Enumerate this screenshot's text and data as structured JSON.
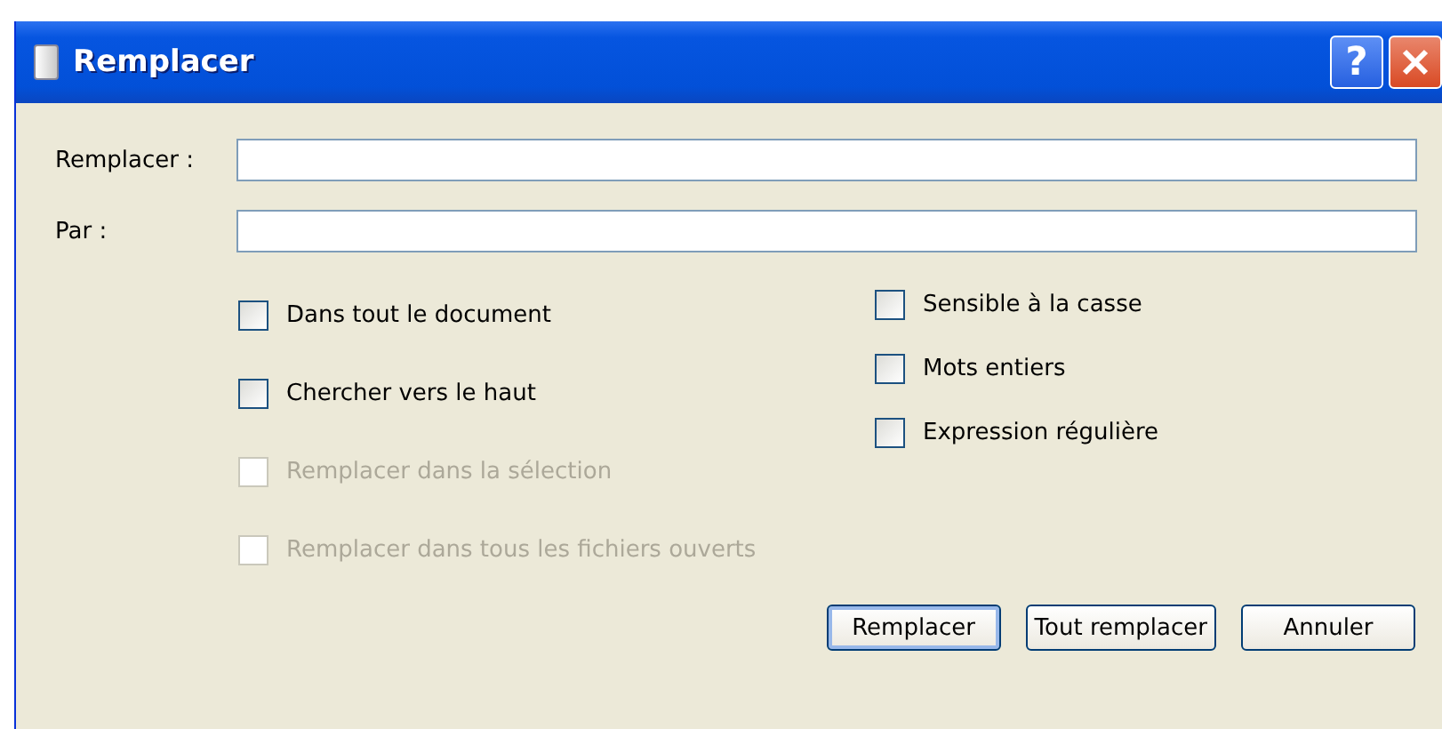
{
  "window": {
    "title": "Remplacer"
  },
  "title_buttons": [
    {
      "kind": "help",
      "label": "?"
    },
    {
      "kind": "close"
    }
  ],
  "fields": [
    {
      "label": "Remplacer :"
    },
    {
      "label": "Par :"
    }
  ],
  "options_left": [
    {
      "label": "Dans tout le document",
      "checked": false,
      "disabled": false
    },
    {
      "label": "Chercher vers le haut",
      "checked": false,
      "disabled": false
    },
    {
      "label": "Remplacer dans la sélection",
      "checked": false,
      "disabled": true
    },
    {
      "label": "Remplacer dans tous les fichiers ouverts",
      "checked": false,
      "disabled": true
    }
  ],
  "options_right": [
    {
      "label": "Sensible à la casse",
      "checked": false,
      "disabled": false
    },
    {
      "label": "Mots entiers",
      "checked": false,
      "disabled": false
    },
    {
      "label": "Expression régulière",
      "checked": false,
      "disabled": false
    }
  ],
  "buttons": [
    {
      "label": "Remplacer",
      "default": true
    },
    {
      "label": "Tout remplacer",
      "default": false
    },
    {
      "label": "Annuler",
      "default": false
    }
  ]
}
